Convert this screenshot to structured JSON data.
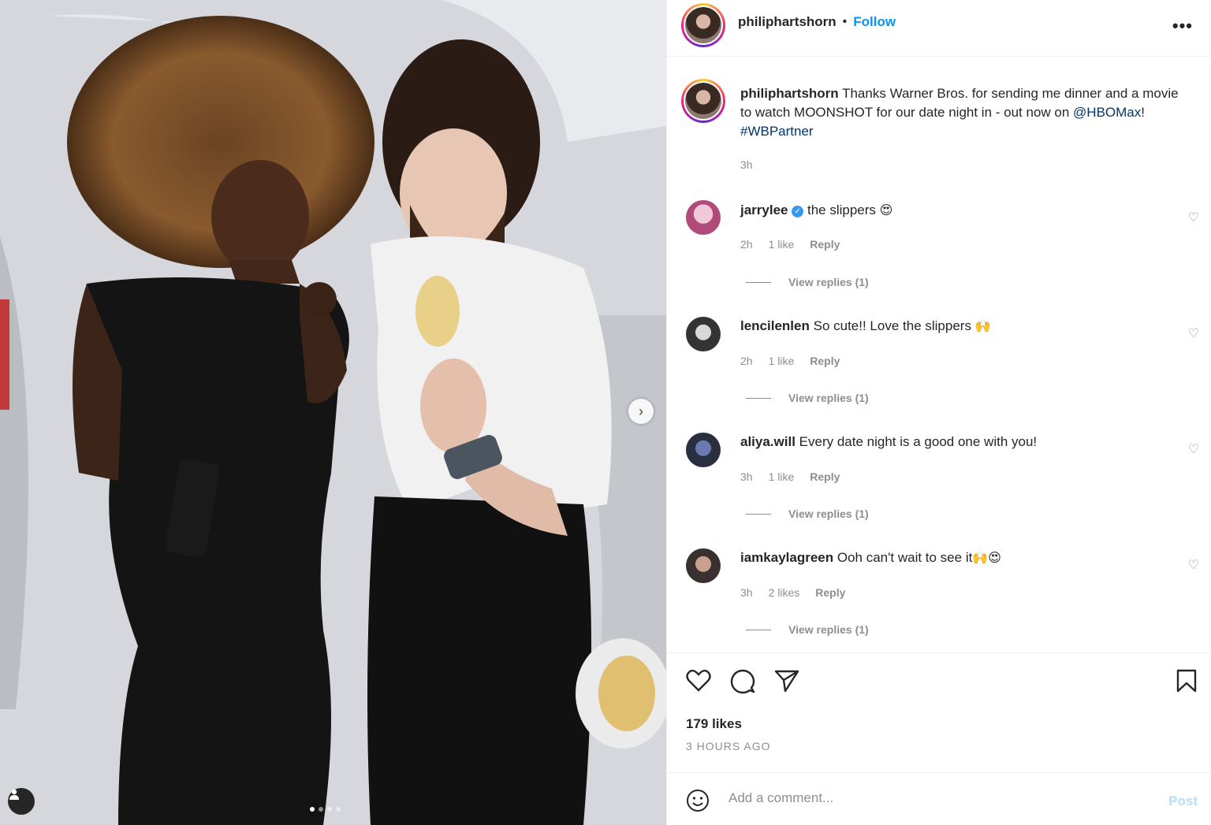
{
  "post": {
    "username": "philiphartshorn",
    "separator": "•",
    "follow_label": "Follow",
    "more_label": "•••",
    "carousel_next": "›",
    "caption_username": "philiphartshorn",
    "caption_text": "Thanks Warner Bros. for sending me dinner and a movie to watch MOONSHOT for our date night in - out now on ",
    "caption_mention": "@HBOMax",
    "caption_after_mention": "! ",
    "caption_hashtag": "#WBPartner",
    "caption_time": "3h"
  },
  "comments": [
    {
      "username": "jarrylee",
      "verified": true,
      "text": "the slippers",
      "emoji": "😍",
      "time": "2h",
      "likes": "1 like",
      "reply": "Reply",
      "view_replies": "View replies (1)"
    },
    {
      "username": "lencilenlen",
      "verified": false,
      "text": "So cute!! Love the slippers",
      "emoji": "🙌",
      "time": "2h",
      "likes": "1 like",
      "reply": "Reply",
      "view_replies": "View replies (1)"
    },
    {
      "username": "aliya.will",
      "verified": false,
      "text": "Every date night is a good one with you!",
      "emoji": "",
      "time": "3h",
      "likes": "1 like",
      "reply": "Reply",
      "view_replies": "View replies (1)"
    },
    {
      "username": "iamkaylagreen",
      "verified": false,
      "text": "Ooh can't wait to see it",
      "emoji": "🙌😍",
      "time": "3h",
      "likes": "2 likes",
      "reply": "Reply",
      "view_replies": "View replies (1)"
    }
  ],
  "footer": {
    "likes": "179 likes",
    "time_ago": "3 HOURS AGO",
    "comment_placeholder": "Add a comment...",
    "post_label": "Post"
  },
  "icons": {
    "like": "heart-icon",
    "comment": "comment-icon",
    "share": "share-icon",
    "save": "bookmark-icon",
    "emoji": "emoji-icon",
    "user_tag": "user-tag-icon"
  },
  "colors": {
    "follow": "#0095f6",
    "link": "#00376b",
    "muted": "#8e8e8e",
    "post_disabled": "#b2dffc"
  }
}
